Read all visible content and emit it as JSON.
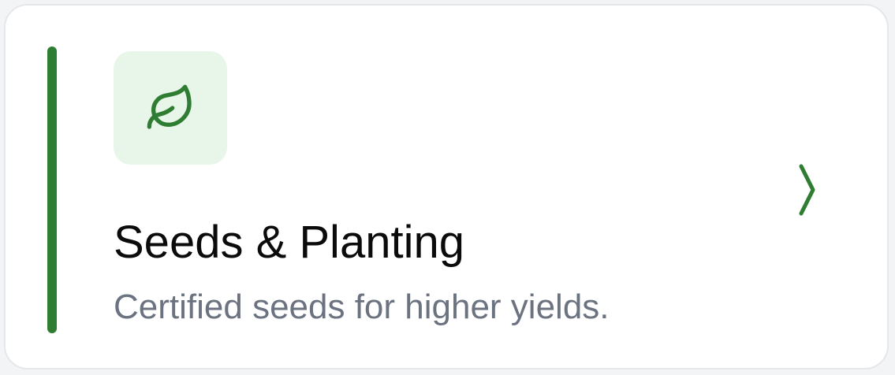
{
  "card": {
    "title": "Seeds & Planting",
    "description": "Certified seeds for higher yields.",
    "icon": "leaf-icon",
    "chevron_icon": "chevron-right-icon"
  },
  "colors": {
    "accent": "#2e7d32",
    "icon_tile_background": "#e8f5e9",
    "title_text": "#0b0b0b",
    "description_text": "#6b7280",
    "card_border": "#e5e7eb"
  }
}
